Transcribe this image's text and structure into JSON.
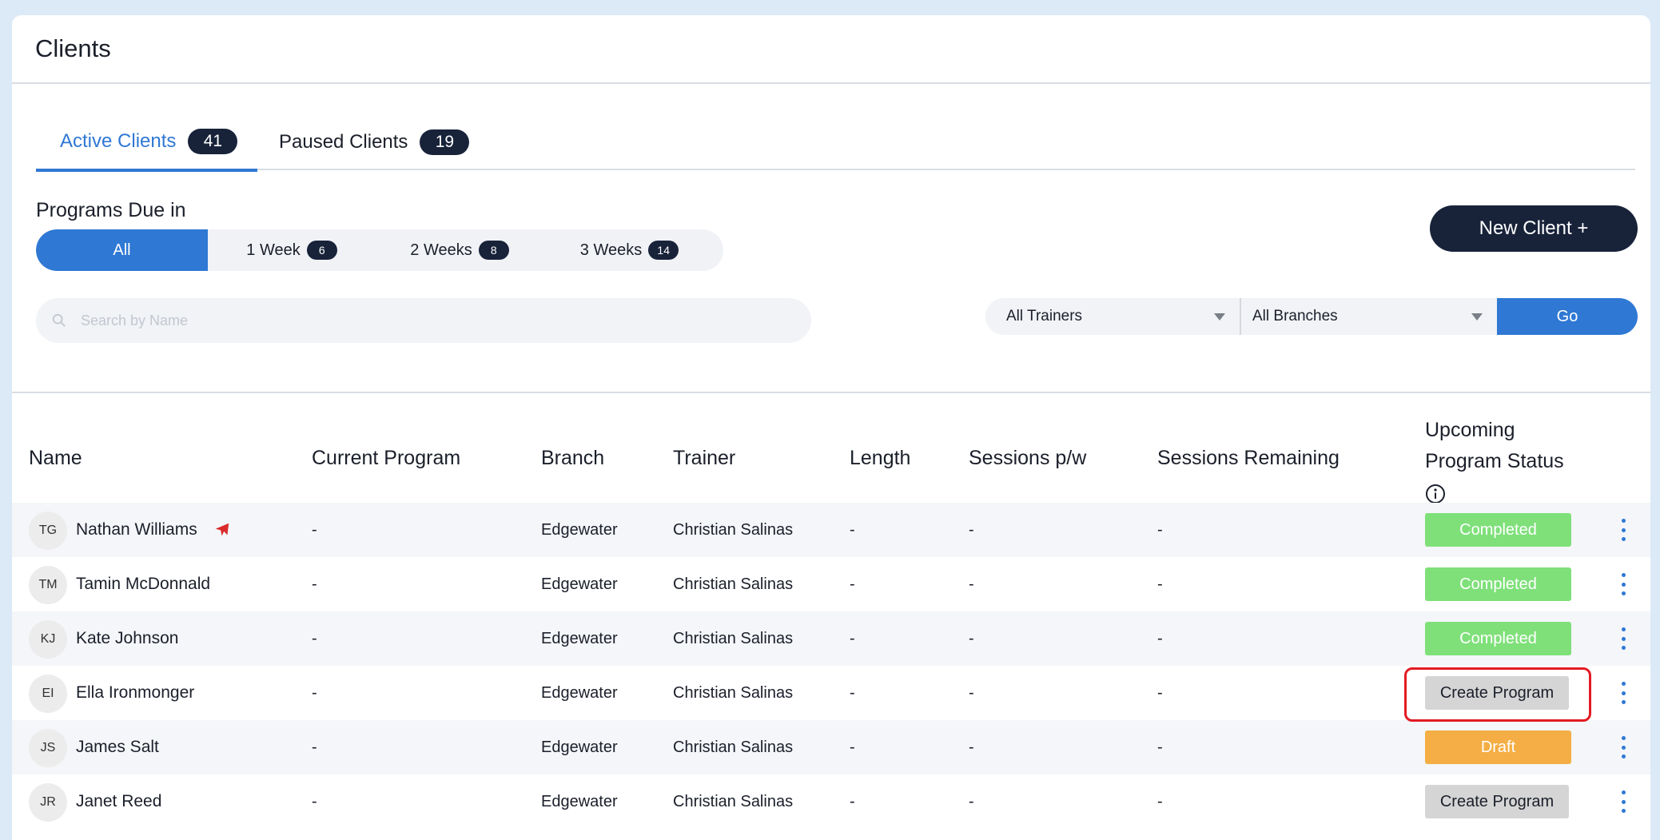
{
  "page": {
    "title": "Clients"
  },
  "tabs": [
    {
      "label": "Active Clients",
      "count": "41"
    },
    {
      "label": "Paused Clients",
      "count": "19"
    }
  ],
  "programs_due": {
    "label": "Programs Due in",
    "options": [
      {
        "label": "All",
        "count": ""
      },
      {
        "label": "1 Week",
        "count": "6"
      },
      {
        "label": "2 Weeks",
        "count": "8"
      },
      {
        "label": "3 Weeks",
        "count": "14"
      }
    ],
    "selected": "All"
  },
  "new_client_label": "New Client +",
  "search": {
    "placeholder": "Search by Name",
    "value": ""
  },
  "filters": {
    "trainers": "All Trainers",
    "branches": "All Branches",
    "go_label": "Go"
  },
  "table": {
    "headers": {
      "name": "Name",
      "current_program": "Current Program",
      "branch": "Branch",
      "trainer": "Trainer",
      "length": "Length",
      "sessions_pw": "Sessions p/w",
      "sessions_remaining": "Sessions Remaining",
      "status_line1": "Upcoming",
      "status_line2": "Program Status"
    },
    "rows": [
      {
        "initials": "TG",
        "name": "Nathan Williams",
        "program": "-",
        "branch": "Edgewater",
        "trainer": "Christian Salinas",
        "length": "-",
        "sessions_pw": "-",
        "remaining": "-",
        "status": "Completed"
      },
      {
        "initials": "TM",
        "name": "Tamin McDonnald",
        "program": "-",
        "branch": "Edgewater",
        "trainer": "Christian Salinas",
        "length": "-",
        "sessions_pw": "-",
        "remaining": "-",
        "status": "Completed"
      },
      {
        "initials": "KJ",
        "name": "Kate Johnson",
        "program": "-",
        "branch": "Edgewater",
        "trainer": "Christian Salinas",
        "length": "-",
        "sessions_pw": "-",
        "remaining": "-",
        "status": "Completed"
      },
      {
        "initials": "EI",
        "name": "Ella Ironmonger",
        "program": "-",
        "branch": "Edgewater",
        "trainer": "Christian Salinas",
        "length": "-",
        "sessions_pw": "-",
        "remaining": "-",
        "status": "Create Program"
      },
      {
        "initials": "JS",
        "name": "James Salt",
        "program": "-",
        "branch": "Edgewater",
        "trainer": "Christian Salinas",
        "length": "-",
        "sessions_pw": "-",
        "remaining": "-",
        "status": "Draft"
      },
      {
        "initials": "JR",
        "name": "Janet Reed",
        "program": "-",
        "branch": "Edgewater",
        "trainer": "Christian Salinas",
        "length": "-",
        "sessions_pw": "-",
        "remaining": "-",
        "status": "Create Program"
      }
    ]
  },
  "colors": {
    "accent": "#2f78d4",
    "dark": "#18233a",
    "completed": "#7fe07a",
    "draft": "#f4ae45",
    "create": "#d5d5d5",
    "highlight": "#e31b23"
  }
}
